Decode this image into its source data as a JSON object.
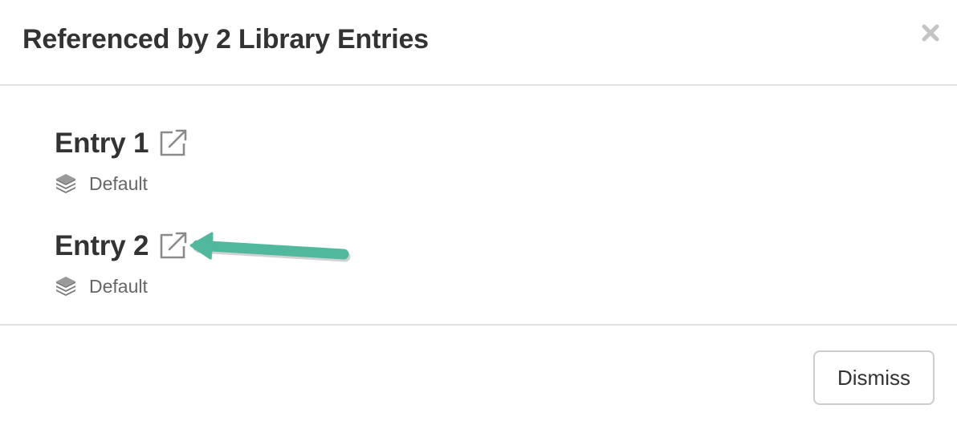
{
  "modal": {
    "title": "Referenced by 2 Library Entries",
    "close_icon": "close-icon",
    "entries": [
      {
        "name": "Entry 1",
        "link_icon": "external-link-icon",
        "library_icon": "layers-icon",
        "library": "Default"
      },
      {
        "name": "Entry 2",
        "link_icon": "external-link-icon",
        "library_icon": "layers-icon",
        "library": "Default"
      }
    ],
    "annotation_arrow_color": "#4fb89d",
    "dismiss_label": "Dismiss"
  }
}
